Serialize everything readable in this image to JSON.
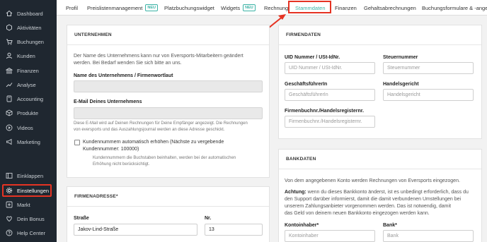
{
  "sidebar": {
    "items": [
      {
        "label": "Dashboard",
        "icon": "home-icon"
      },
      {
        "label": "Aktivitäten",
        "icon": "activity-icon"
      },
      {
        "label": "Buchungen",
        "icon": "cart-icon"
      },
      {
        "label": "Kunden",
        "icon": "user-icon"
      },
      {
        "label": "Finanzen",
        "icon": "bank-icon"
      },
      {
        "label": "Analyse",
        "icon": "trend-icon"
      },
      {
        "label": "Accounting",
        "icon": "calculator-icon"
      },
      {
        "label": "Produkte",
        "icon": "box-icon"
      },
      {
        "label": "Videos",
        "icon": "play-icon"
      },
      {
        "label": "Marketing",
        "icon": "megaphone-icon"
      },
      {
        "label": "Einklappen",
        "icon": "collapse-icon"
      },
      {
        "label": "Einstellungen",
        "icon": "gear-icon"
      },
      {
        "label": "Markt",
        "icon": "plus-box-icon"
      },
      {
        "label": "Dein Bonus",
        "icon": "heart-icon"
      },
      {
        "label": "Help Center",
        "icon": "help-icon"
      }
    ]
  },
  "tabs": [
    {
      "label": "Profil",
      "badge": ""
    },
    {
      "label": "Preislistenmanagement",
      "badge": "NEU"
    },
    {
      "label": "Platzbuchungswidget",
      "badge": ""
    },
    {
      "label": "Widgets",
      "badge": "NEU"
    },
    {
      "label": "Rechnung",
      "badge": ""
    },
    {
      "label": "Stammdaten",
      "badge": ""
    },
    {
      "label": "Finanzen",
      "badge": ""
    },
    {
      "label": "Gehaltsabrechnungen",
      "badge": ""
    },
    {
      "label": "Buchungsformulare & -angeb",
      "badge": ""
    }
  ],
  "unternehmen": {
    "title": "UNTERNEHMEN",
    "intro_line1": "Der Name des Unternehmens kann nur von Eversports-Mitarbeitern geändert",
    "intro_line2": "werden. Bei Bedarf wenden Sie sich bitte an uns.",
    "name_label": "Name des Unternehmens / Firmenwortlaut",
    "email_label": "E-Mail Deines Unternehmens",
    "email_help_line1": "Diese E-Mail wird auf Deinen Rechnungen für Deine Empfänger angezeigt. Die Rechnungen",
    "email_help_line2": "von eversports und das Auszahlungsjournal werden an diese Adresse geschickt.",
    "checkbox_line1": "Kundennummern automatisch erhöhen (Nächste zu vergebende",
    "checkbox_line2": "Kundennummer: 100000)",
    "checkbox_help_line1": "Kundennummern die Buchstaben beinhalten, werden bei der automatischen",
    "checkbox_help_line2": "Erhöhung nicht berücksichtigt."
  },
  "firmenadresse": {
    "title": "FIRMENADRESSE*",
    "street_label": "Straße",
    "street_value": "Jakov-Lind-Straße",
    "number_label": "Nr.",
    "number_value": "13"
  },
  "firmendaten": {
    "title": "FIRMENDATEN",
    "uid_label": "UID Nummer / USt-IdNr.",
    "uid_placeholder": "UID Nummer / USt-IdNr.",
    "tax_label": "Steuernummer",
    "tax_placeholder": "Steuernummer",
    "ceo_label": "GeschäftsführerIn",
    "ceo_placeholder": "GeschäftsführerIn",
    "court_label": "Handelsgericht",
    "court_placeholder": "Handelsgericht",
    "register_label": "Firmenbuchnr./Handelsregisternr.",
    "register_placeholder": "Firmenbuchnr./Handelsregisternr."
  },
  "bankdaten": {
    "title": "BANKDATEN",
    "intro": "Von dem angegebenen Konto werden Rechnungen von Eversports eingezogen.",
    "warn_bold": "Achtung:",
    "warn_line1": " wenn du dieses Bankkonto änderst, ist es unbedingt erforderlich, dass du",
    "warn_line2": "den Support darüber informierst, damit die damit verbundenen Umstellungen bei",
    "warn_line3": "unserem Zahlungsanbieter vorgenommen werden. Das ist notwendig, damit",
    "warn_line4": "das Geld von deinem neuen Bankkonto eingezogen werden kann.",
    "owner_label": "Kontoinhaber*",
    "owner_placeholder": "Kontoinhaber",
    "bank_label": "Bank*",
    "bank_placeholder": "Bank"
  },
  "colors": {
    "accent": "#3bb3a6",
    "highlight": "#e53323",
    "sidebar": "#1f2730"
  }
}
